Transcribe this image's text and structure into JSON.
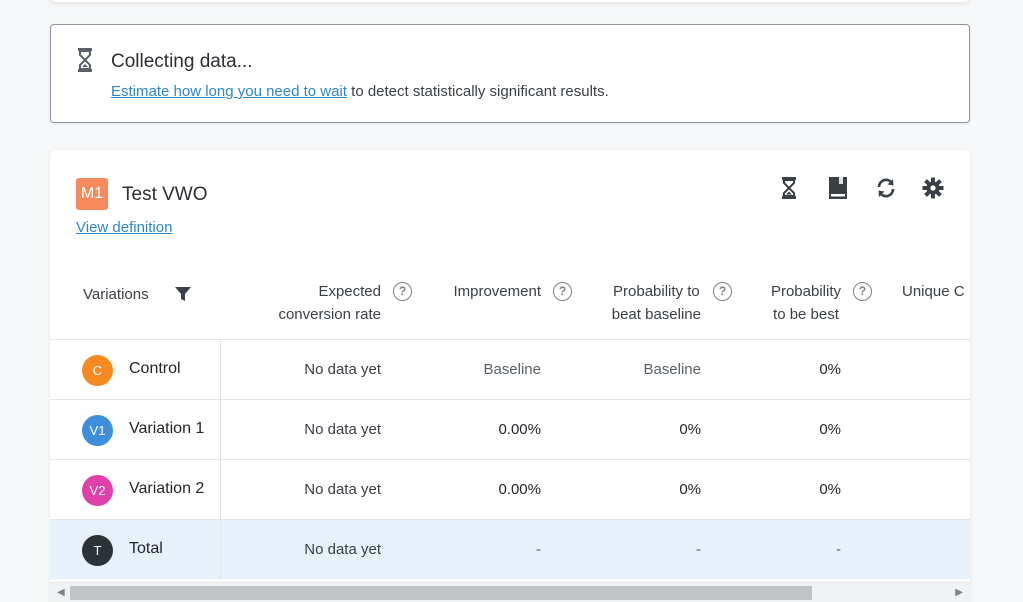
{
  "notice": {
    "title": "Collecting data...",
    "link_text": "Estimate how long you need to wait",
    "rest_text": " to detect statistically significant results."
  },
  "metric": {
    "badge": "M1",
    "title": "Test VWO",
    "view_definition": "View definition",
    "badge_color": "#f58b5c",
    "action_icons": [
      "hourglass-icon",
      "book-icon",
      "refresh-icon",
      "gear-icon"
    ]
  },
  "table": {
    "headers": {
      "variations": "Variations",
      "expected_1": "Expected",
      "expected_2": "conversion rate",
      "improvement": "Improvement",
      "prob_beat_1": "Probability to",
      "prob_beat_2": "beat baseline",
      "prob_best_1": "Probability",
      "prob_best_2": "to be best",
      "unique": "Unique C"
    },
    "rows": [
      {
        "initial": "C",
        "name": "Control",
        "color": "#f6891f",
        "expected": "No data yet",
        "improvement": "Baseline",
        "prob_beat": "Baseline",
        "prob_best": "0%"
      },
      {
        "initial": "V1",
        "name": "Variation 1",
        "color": "#3d8fdc",
        "expected": "No data yet",
        "improvement": "0.00%",
        "prob_beat": "0%",
        "prob_best": "0%"
      },
      {
        "initial": "V2",
        "name": "Variation 2",
        "color": "#e040a8",
        "expected": "No data yet",
        "improvement": "0.00%",
        "prob_beat": "0%",
        "prob_best": "0%"
      },
      {
        "initial": "T",
        "name": "Total",
        "color": "#2c3338",
        "expected": "No data yet",
        "improvement": "-",
        "prob_beat": "-",
        "prob_best": "-"
      }
    ]
  }
}
